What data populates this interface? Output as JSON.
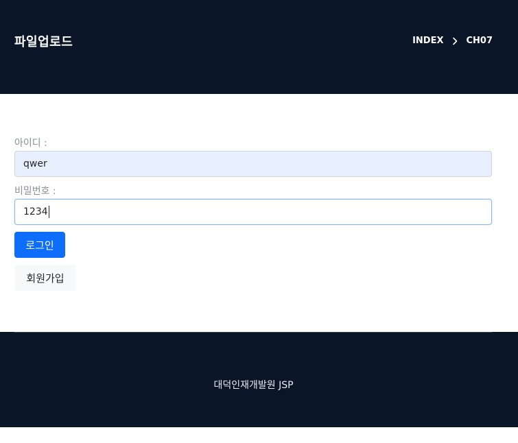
{
  "header": {
    "title": "파일업로드",
    "breadcrumb": [
      "INDEX",
      "CH07"
    ]
  },
  "form": {
    "id_label": "아이디 :",
    "id_value": "qwer",
    "pw_label": "비밀번호 :",
    "pw_value": "1234",
    "login_button": "로그인",
    "signup_button": "회원가입"
  },
  "footer": {
    "text": "대덕인재개발원 JSP"
  },
  "colors": {
    "header_bg": "#0a1628",
    "primary": "#0d6efd",
    "autofill_bg": "#e8f0fe"
  },
  "icons": {
    "breadcrumb_separator": "chevron-right-icon"
  }
}
